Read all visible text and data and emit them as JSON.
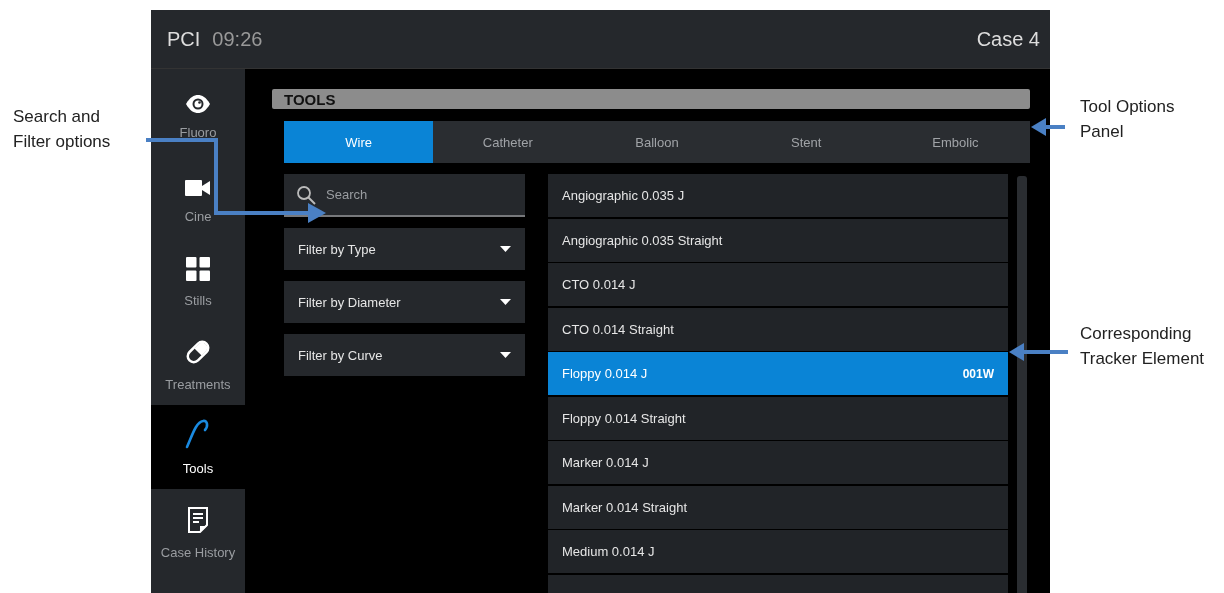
{
  "annotations": [
    {
      "lines": [
        "Search and",
        "Filter options"
      ],
      "kind": "left"
    },
    {
      "lines": [
        "Tool Options",
        "Panel"
      ],
      "kind": "right"
    },
    {
      "lines": [
        "Corresponding",
        "Tracker Element"
      ],
      "kind": "right"
    }
  ],
  "top_bar": {
    "app": "PCI",
    "time": "09:26",
    "case": "Case 4"
  },
  "sidebar": {
    "items": [
      {
        "label": "Fluoro",
        "selected": false
      },
      {
        "label": "Cine",
        "selected": false
      },
      {
        "label": "Stills",
        "selected": false
      },
      {
        "label": "Treatments",
        "selected": false
      },
      {
        "label": "Tools",
        "selected": true
      },
      {
        "label": "Case History",
        "selected": false
      }
    ]
  },
  "panel": {
    "title": "TOOLS"
  },
  "tabs": [
    {
      "label": "Wire",
      "selected": true
    },
    {
      "label": "Catheter",
      "selected": false
    },
    {
      "label": "Balloon",
      "selected": false
    },
    {
      "label": "Stent",
      "selected": false
    },
    {
      "label": "Embolic",
      "selected": false
    }
  ],
  "search": {
    "placeholder": "Search"
  },
  "filters": [
    "Filter by Type",
    "Filter by Diameter",
    "Filter by Curve"
  ],
  "list": {
    "rows": [
      {
        "label": "Angiographic 0.035 J",
        "selected": false
      },
      {
        "label": "Angiographic 0.035 Straight",
        "selected": false
      },
      {
        "label": "CTO 0.014 J",
        "selected": false
      },
      {
        "label": "CTO 0.014 Straight",
        "selected": false
      },
      {
        "label": "Floppy 0.014 J",
        "code": "001W",
        "selected": true
      },
      {
        "label": "Floppy 0.014 Straight",
        "selected": false
      },
      {
        "label": "Marker 0.014 J",
        "selected": false
      },
      {
        "label": "Marker 0.014 Straight",
        "selected": false
      },
      {
        "label": "Medium 0.014 J",
        "selected": false
      }
    ]
  }
}
